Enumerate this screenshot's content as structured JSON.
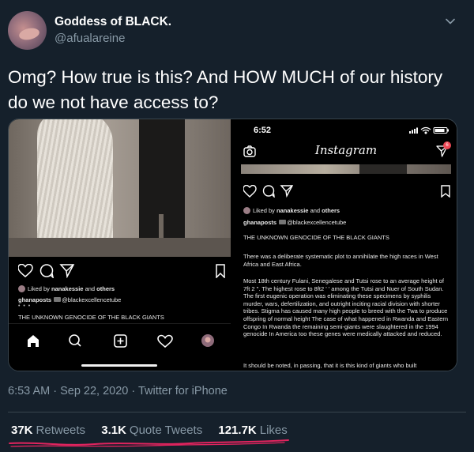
{
  "user": {
    "display_name": "Goddess of BLACK.",
    "handle": "@afualareine"
  },
  "tweet": {
    "text": "Omg? How true is this? And HOW MUCH of our history do we not have access to?"
  },
  "media": {
    "left": {
      "liked_prefix": "Liked by ",
      "liked_user1": "nanakessie",
      "liked_mid": " and ",
      "liked_user2": "others",
      "username": "ghanaposts",
      "mention": "@blackexcellencetube",
      "dots": "• • •",
      "caption": "THE UNKNOWN GENOCIDE OF THE BLACK GIANTS"
    },
    "right": {
      "time": "6:52",
      "app_title": "Instagram",
      "badge": "6",
      "liked_prefix": "Liked by ",
      "liked_user1": "nanakessie",
      "liked_mid": " and ",
      "liked_user2": "others",
      "username": "ghanaposts",
      "mention": "@blackexcellencetube",
      "heading": "THE UNKNOWN GENOCIDE OF THE BLACK GIANTS",
      "para1": "There was a deliberate systematic plot to annihilate the high races in West Africa and East Africa.",
      "para2": "Most 18th century Fulani, Senegalese and Tutsi rose to an average height of 7ft 2 \". The highest rose to 8ft2 ' ' among the Tutsi and Nuer of South Sudan. The first eugenic operation was eliminating these specimens by syphilis murder, wars, defertilization, and outright inciting racial division with shorter tribes. Stigma has caused many high people to breed with the Twa to produce offspring of normal height The case of what happened in Rwanda and Eastern Congo In Rwanda the remaining semi-giants were slaughtered in the 1994 genocide In America too these genes were medically attacked and reduced.",
      "para3": "It should be noted, in passing, that it is this kind of giants who built"
    }
  },
  "meta": {
    "time": "6:53 AM",
    "sep1": " · ",
    "date": "Sep 22, 2020",
    "sep2": " · ",
    "source": "Twitter for iPhone"
  },
  "stats": {
    "retweets_count": "37K",
    "retweets_label": "Retweets",
    "quotes_count": "3.1K",
    "quotes_label": "Quote Tweets",
    "likes_count": "121.7K",
    "likes_label": "Likes"
  },
  "colors": {
    "background": "#15202b",
    "secondary_text": "#8899a6",
    "divider": "#38444d",
    "annotation": "#e0245e"
  }
}
